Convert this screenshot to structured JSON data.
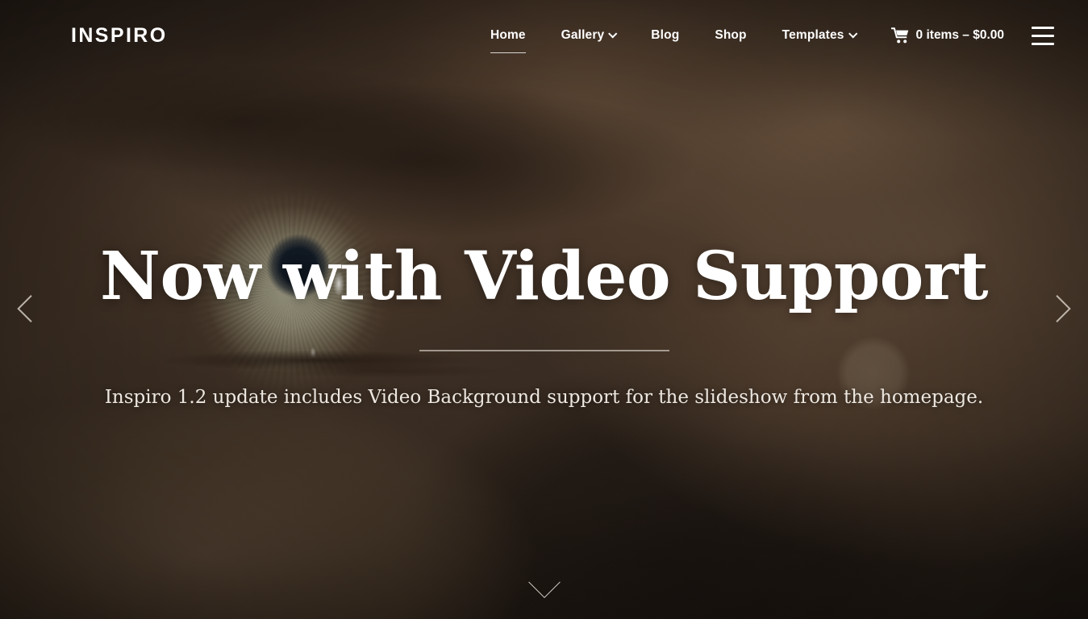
{
  "header": {
    "brand": "INSPIRO",
    "nav": [
      {
        "label": "Home",
        "icon": null,
        "active": true
      },
      {
        "label": "Gallery",
        "icon": "chevron-down-icon",
        "active": false
      },
      {
        "label": "Blog",
        "icon": null,
        "active": false
      },
      {
        "label": "Shop",
        "icon": null,
        "active": false
      },
      {
        "label": "Templates",
        "icon": "chevron-down-icon",
        "active": false
      }
    ],
    "cart": {
      "icon": "shopping-cart-icon",
      "label": "0 items – $0.00",
      "item_count": "0",
      "total": "$0.00"
    },
    "menu_toggle_icon": "hamburger-menu-icon"
  },
  "slide": {
    "title": "Now with Video Support",
    "subtitle": "Inspiro 1.2 update includes Video Background support for the slideshow from the homepage.",
    "divider": true
  },
  "slider": {
    "prev_icon": "chevron-left-icon",
    "next_icon": "chevron-right-icon",
    "scroll_down_icon": "chevron-down-icon"
  },
  "colors": {
    "text_light": "#ffffff",
    "subtitle": "#ece7e0",
    "divider": "#e1dad0",
    "background_dark": "#3a2d22",
    "background_warm": "#6b5440"
  }
}
